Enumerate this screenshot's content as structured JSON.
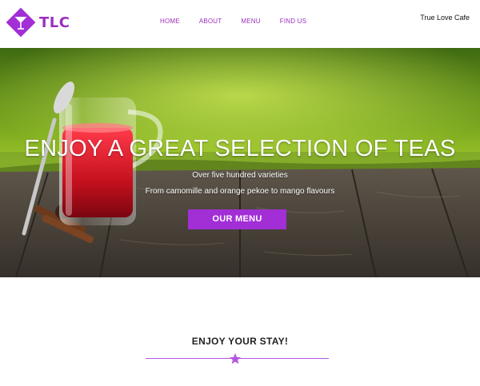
{
  "header": {
    "logo_text": "TLC",
    "logo_icon": "cocktail-glass-icon",
    "nav": [
      {
        "label": "HOME"
      },
      {
        "label": "ABOUT"
      },
      {
        "label": "MENU"
      },
      {
        "label": "FIND US"
      }
    ],
    "brand_name": "True Love Cafe"
  },
  "hero": {
    "title": "ENJOY A GREAT SELECTION OF TEAS",
    "subtitle_line1": "Over five hundred varieties",
    "subtitle_line2": "From camomille and orange pekoe to mango flavours",
    "button_label": "OUR MENU"
  },
  "welcome": {
    "title": "ENJOY YOUR STAY!",
    "divider_icon": "star-icon"
  },
  "colors": {
    "accent": "#a22ed6",
    "nav_text": "#9b2fbf",
    "divider": "#b558e0"
  }
}
